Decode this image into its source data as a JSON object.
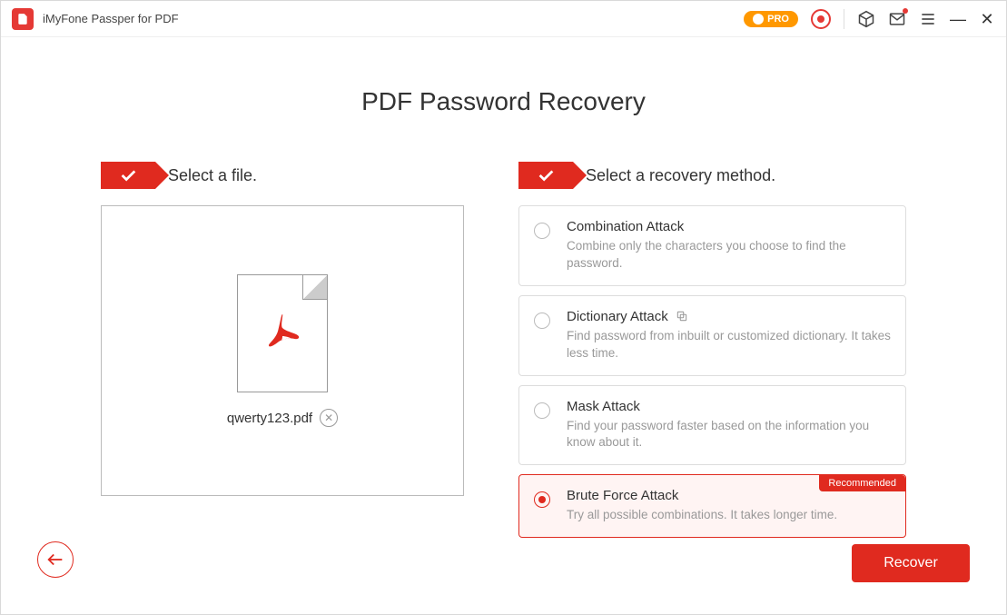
{
  "titlebar": {
    "app_title": "iMyFone Passper for PDF",
    "pro_label": "PRO"
  },
  "page": {
    "title": "PDF Password Recovery"
  },
  "left": {
    "flag_label": "Select a file.",
    "filename": "qwerty123.pdf"
  },
  "right": {
    "flag_label": "Select a recovery method.",
    "methods": [
      {
        "title": "Combination Attack",
        "desc": "Combine only the characters you choose to find the password."
      },
      {
        "title": "Dictionary Attack",
        "desc": "Find password from inbuilt or customized dictionary. It takes less time."
      },
      {
        "title": "Mask Attack",
        "desc": "Find your password faster based on the information you know about it."
      },
      {
        "title": "Brute Force Attack",
        "desc": "Try all possible combinations. It takes longer time."
      }
    ],
    "recommended_label": "Recommended"
  },
  "footer": {
    "recover_label": "Recover"
  }
}
